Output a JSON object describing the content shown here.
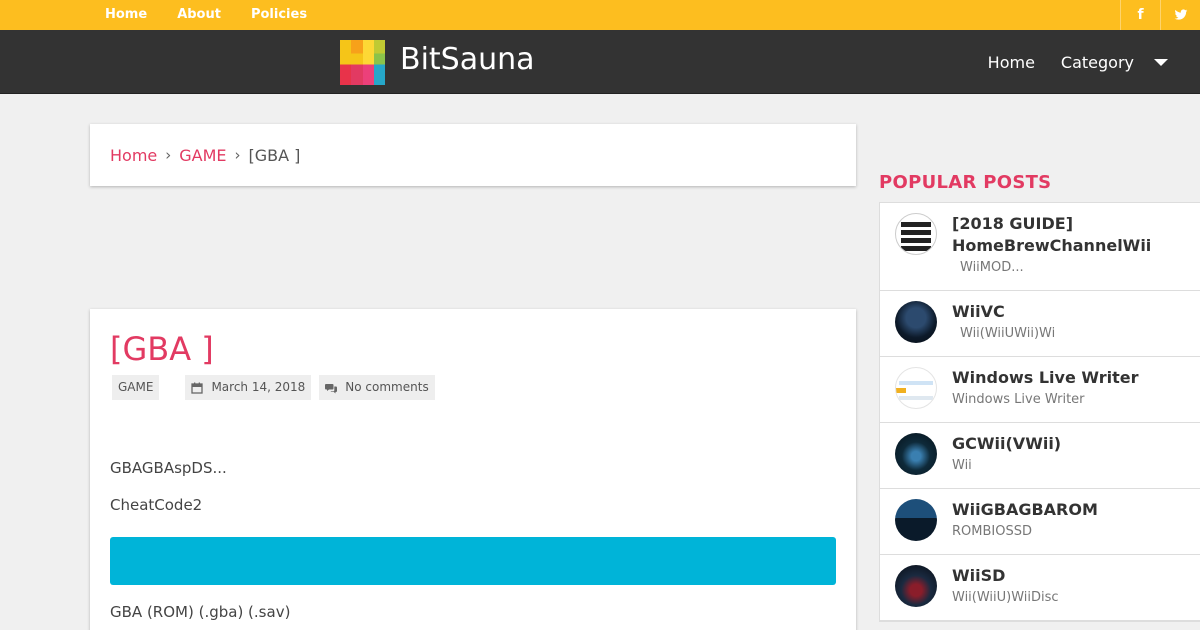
{
  "topnav": {
    "items": [
      "Home",
      "About",
      "Policies"
    ]
  },
  "social": {
    "facebook": "f"
  },
  "header": {
    "site_title": "BitSauna",
    "nav_home": "Home",
    "nav_category": "Category"
  },
  "colors": {
    "accent": "#e23a62",
    "topbar": "#fdbe1f",
    "header": "#333333",
    "banner": "#00b4d8"
  },
  "breadcrumb": {
    "home": "Home",
    "category": "GAME",
    "current": "[GBA ]"
  },
  "post": {
    "title": "[GBA ]",
    "category": "GAME",
    "date": "March 14, 2018",
    "comments": "No comments",
    "paragraphs": [
      "GBAGBAspDS...",
      "CheatCode2",
      "GBA (ROM)  (.gba)  (.sav)"
    ]
  },
  "sidebar": {
    "title": "POPULAR POSTS",
    "posts": [
      {
        "title": "[2018 GUIDE] HomeBrewChannelWii",
        "snippet": "WiiMOD...",
        "icon": "homebrew-thumb"
      },
      {
        "title": "WiiVC",
        "snippet": "Wii(WiiUWii)Wi",
        "icon": "wiivc-thumb"
      },
      {
        "title": "Windows Live Writer",
        "snippet": "Windows Live Writer",
        "icon": "livewriter-thumb"
      },
      {
        "title": "GCWii(VWii)",
        "snippet": "Wii",
        "icon": "gcwii-thumb"
      },
      {
        "title": "WiiGBAGBAROM",
        "snippet": "ROMBIOSSD",
        "icon": "wiigba-thumb"
      },
      {
        "title": "WiiSD",
        "snippet": "Wii(WiiU)WiiDisc",
        "icon": "wiisd-thumb"
      }
    ]
  }
}
